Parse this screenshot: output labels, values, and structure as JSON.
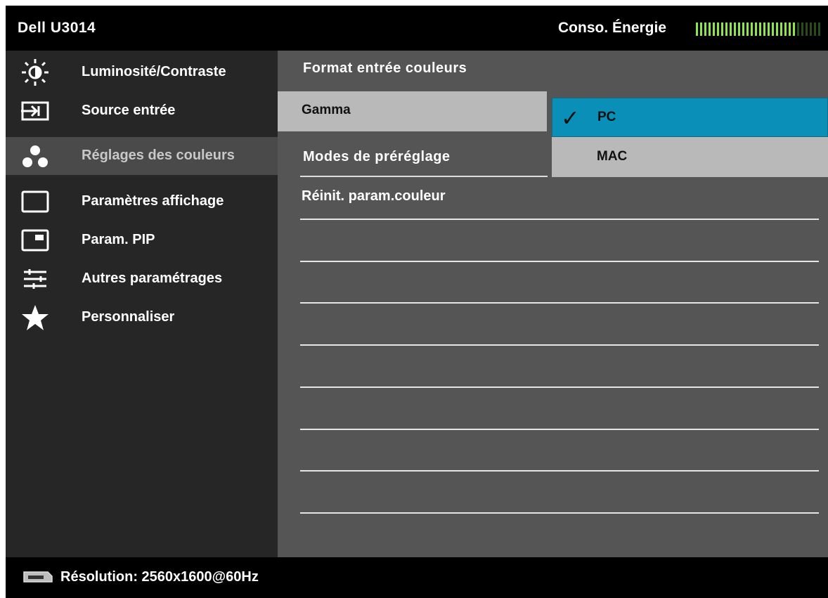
{
  "header": {
    "model": "Dell U3014",
    "energy_label": "Conso. Énergie",
    "energy_level": 0.8
  },
  "sidebar": {
    "items": [
      {
        "label": "Luminosité/Contraste",
        "icon": "brightness-icon",
        "active": false
      },
      {
        "label": "Source entrée",
        "icon": "input-source-icon",
        "active": false
      },
      {
        "label": "Réglages des couleurs",
        "icon": "color-settings-icon",
        "active": true
      },
      {
        "label": "Paramètres affichage",
        "icon": "display-icon",
        "active": false
      },
      {
        "label": "Param. PIP",
        "icon": "pip-icon",
        "active": false
      },
      {
        "label": "Autres paramétrages",
        "icon": "sliders-icon",
        "active": false
      },
      {
        "label": "Personnaliser",
        "icon": "star-icon",
        "active": false
      }
    ]
  },
  "main": {
    "items": [
      {
        "label": "Format entrée couleurs"
      },
      {
        "label": "Gamma"
      },
      {
        "label": "Modes de préréglage"
      },
      {
        "label": "Réinit. param.couleur"
      }
    ]
  },
  "submenu": {
    "options": [
      {
        "label": "PC",
        "selected": true,
        "check": "✓"
      },
      {
        "label": "MAC",
        "selected": false
      }
    ]
  },
  "footer": {
    "resolution": "Résolution: 2560x1600@60Hz"
  },
  "colors": {
    "accent": "#0a8fb8",
    "sidebar_bg": "#262626",
    "main_bg": "#555555",
    "highlight_gray": "#b9b9b9",
    "energy_on": "#8fe34b"
  }
}
